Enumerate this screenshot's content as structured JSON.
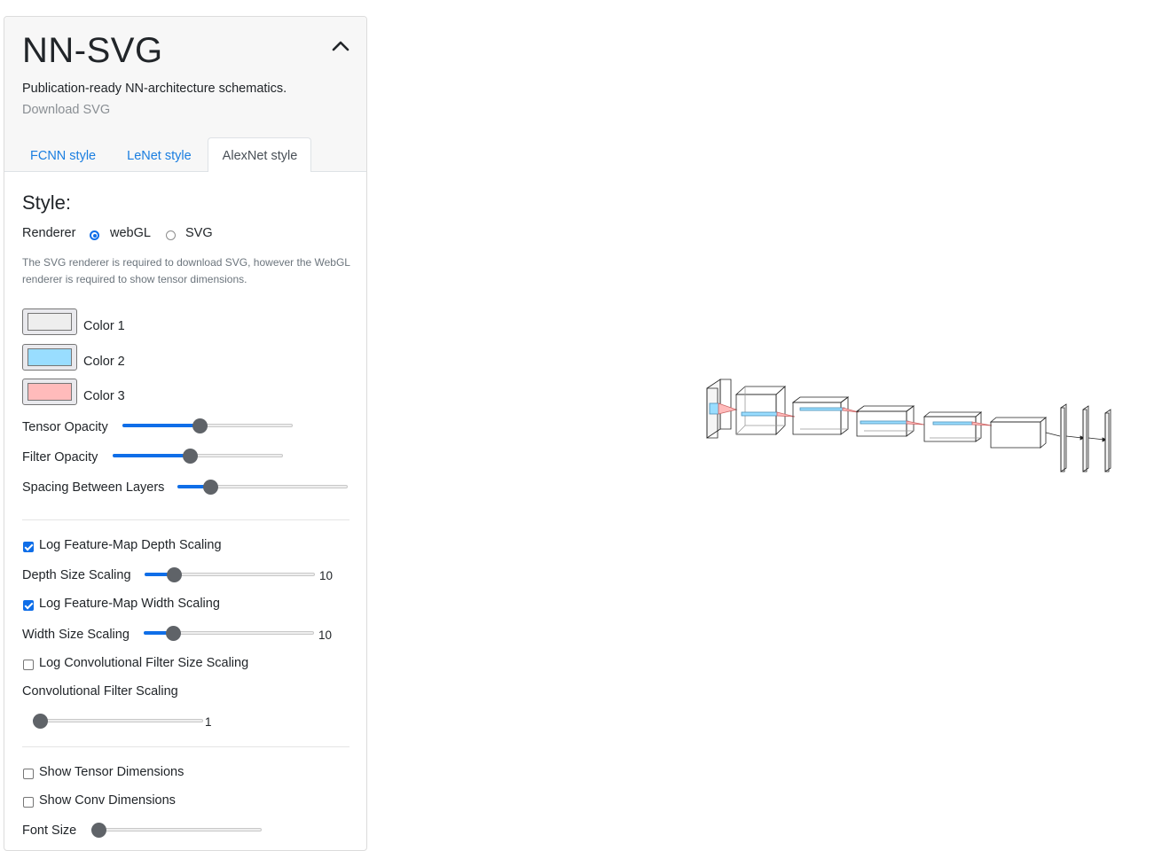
{
  "header": {
    "title": "NN-SVG",
    "subtitle": "Publication-ready NN-architecture schematics.",
    "download_label": "Download SVG"
  },
  "tabs": [
    {
      "label": "FCNN style",
      "active": false
    },
    {
      "label": "LeNet style",
      "active": false
    },
    {
      "label": "AlexNet style",
      "active": true
    }
  ],
  "style": {
    "heading": "Style:",
    "renderer_label": "Renderer",
    "renderer_options": [
      {
        "label": "webGL",
        "selected": true
      },
      {
        "label": "SVG",
        "selected": false
      }
    ],
    "note": "The SVG renderer is required to download SVG, however the WebGL renderer is required to show tensor dimensions.",
    "colors": [
      {
        "label": "Color 1",
        "value": "#eeeeee"
      },
      {
        "label": "Color 2",
        "value": "#99ddff"
      },
      {
        "label": "Color 3",
        "value": "#ffbbbb"
      }
    ],
    "tensor_opacity": {
      "label": "Tensor Opacity",
      "fraction": 0.41
    },
    "filter_opacity": {
      "label": "Filter Opacity",
      "fraction": 0.41
    },
    "spacing": {
      "label": "Spacing Between Layers",
      "fraction": 0.15
    }
  },
  "scaling": {
    "log_depth": {
      "label": "Log Feature-Map Depth Scaling",
      "checked": true
    },
    "depth_size": {
      "label": "Depth Size Scaling",
      "value": "10",
      "fraction": 0.13
    },
    "log_width": {
      "label": "Log Feature-Map Width Scaling",
      "checked": true
    },
    "width_size": {
      "label": "Width Size Scaling",
      "value": "10",
      "fraction": 0.13
    },
    "log_conv": {
      "label": "Log Convolutional Filter Size Scaling",
      "checked": false
    },
    "conv_filter": {
      "label": "Convolutional Filter Scaling",
      "value": "1",
      "fraction": 0.0
    }
  },
  "dimensions": {
    "show_tensor": {
      "label": "Show Tensor Dimensions",
      "checked": false
    },
    "show_conv": {
      "label": "Show Conv Dimensions",
      "checked": false
    },
    "font_size": {
      "label": "Font Size",
      "fraction": 0.0
    }
  },
  "accent_color": "#0f6ee8",
  "link_color": "#1a7ee0"
}
